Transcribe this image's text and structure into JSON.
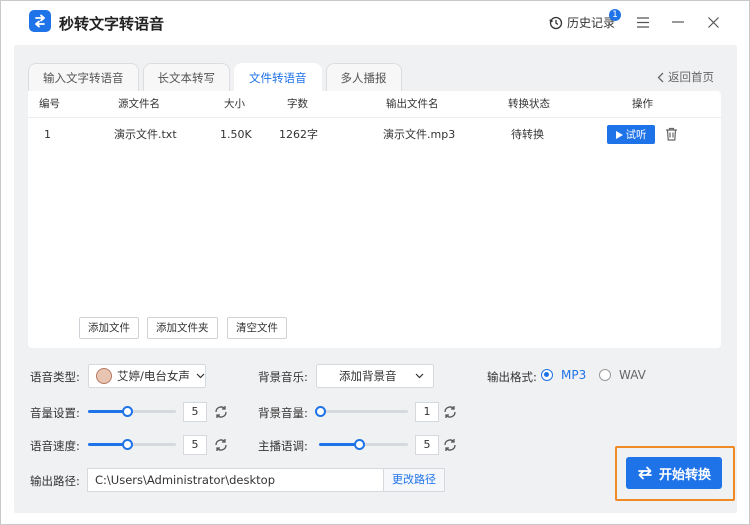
{
  "app": {
    "title": "秒转文字转语音"
  },
  "titlebar": {
    "history_label": "历史记录",
    "history_badge": "1"
  },
  "tabs": [
    {
      "label": "输入文字转语音",
      "active": false
    },
    {
      "label": "长文本转写",
      "active": false
    },
    {
      "label": "文件转语音",
      "active": true
    },
    {
      "label": "多人播报",
      "active": false
    }
  ],
  "back_link": "返回首页",
  "table": {
    "columns": [
      "编号",
      "源文件名",
      "大小",
      "字数",
      "输出文件名",
      "转换状态",
      "操作"
    ],
    "rows": [
      {
        "id": "1",
        "source": "演示文件.txt",
        "size": "1.50K",
        "chars": "1262字",
        "output": "演示文件.mp3",
        "status": "待转换",
        "play_label": "试听"
      }
    ]
  },
  "file_buttons": {
    "add_file": "添加文件",
    "add_folder": "添加文件夹",
    "clear": "清空文件"
  },
  "settings": {
    "voice_type_label": "语音类型:",
    "voice_type_value": "艾婷/电台女声",
    "bg_music_label": "背景音乐:",
    "bg_music_value": "添加背景音",
    "format_label": "输出格式:",
    "formats": [
      {
        "label": "MP3",
        "selected": true
      },
      {
        "label": "WAV",
        "selected": false
      }
    ],
    "volume_label": "音量设置:",
    "volume_value": "5",
    "bg_volume_label": "背景音量:",
    "bg_volume_value": "1",
    "speed_label": "语音速度:",
    "speed_value": "5",
    "pitch_label": "主播语调:",
    "pitch_value": "5",
    "path_label": "输出路径:",
    "path_value": "C:\\Users\\Administrator\\desktop",
    "change_path_label": "更改路径"
  },
  "start_button": "开始转换",
  "colors": {
    "accent": "#1f73e8",
    "highlight": "#f08a24"
  }
}
